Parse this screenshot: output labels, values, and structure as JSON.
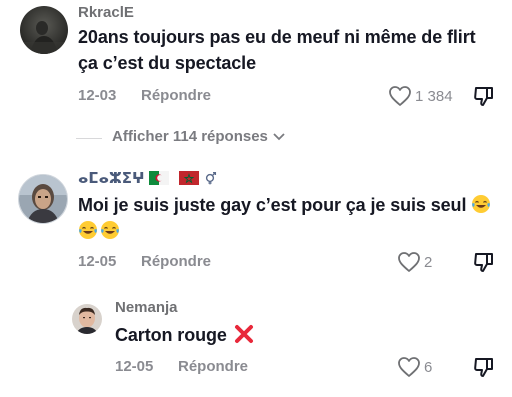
{
  "comments": [
    {
      "username": "RkraclE",
      "text_line1": "20ans toujours pas eu de meuf ni même de flirt",
      "text_line2": "ça c’est du spectacle",
      "date": "12-03",
      "reply_label": "Répondre",
      "likes": "1 384"
    },
    {
      "username_prefix": "ⴰⵎⴰⵣⵉⵖ",
      "text_line1": "Moi je suis juste gay c’est pour ça je suis seul",
      "date": "12-05",
      "reply_label": "Répondre",
      "likes": "2"
    }
  ],
  "view_replies": {
    "label": "Afficher 114 réponses"
  },
  "reply": {
    "username": "Nemanja",
    "text": "Carton rouge",
    "date": "12-05",
    "reply_label": "Répondre",
    "likes": "6"
  },
  "colors": {
    "text": "#161823",
    "muted": "#8a8b91",
    "emoji_red": "#e8283a"
  },
  "icons": [
    "heart-icon",
    "dislike-icon",
    "chevron-down-icon",
    "cross-mark-icon",
    "tears-of-joy-icon",
    "flag-algeria-icon",
    "flag-morocco-icon",
    "male-female-icon"
  ]
}
